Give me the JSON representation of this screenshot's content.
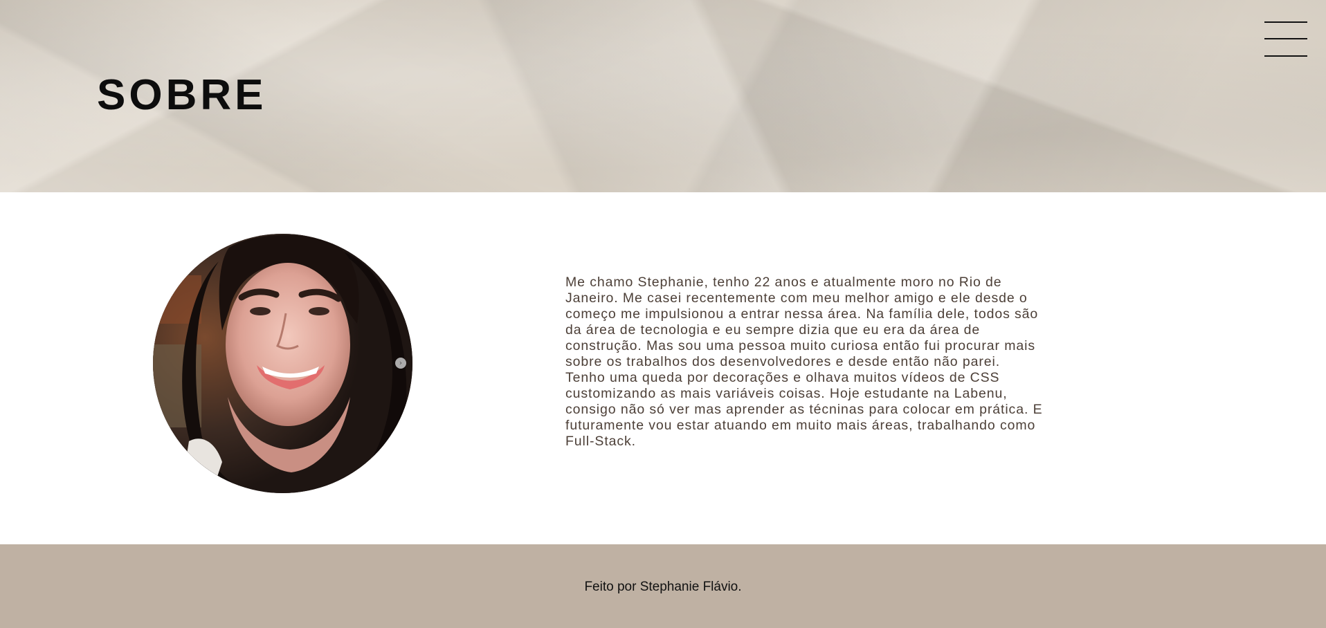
{
  "header": {
    "title": "SOBRE",
    "menu_icon": "hamburger-menu-icon"
  },
  "about": {
    "photo_alt": "Stephanie Flávio",
    "photo_nav_icon": "chevron-right-icon",
    "bio": "Me chamo Stephanie, tenho 22 anos e atualmente moro no Rio de Janeiro. Me casei recentemente com meu melhor amigo e ele desde o começo me impulsionou a entrar nessa área. Na família dele, todos são da área de tecnologia e eu sempre dizia que eu era da área de construção. Mas sou uma pessoa muito curiosa então fui procurar mais sobre os trabalhos dos desenvolvedores e desde então não parei. Tenho uma queda por decorações e olhava muitos vídeos de CSS customizando as mais variáveis coisas. Hoje estudante na Labenu, consigo não só ver mas aprender as técninas para colocar em prática. E futuramente vou estar atuando em muito mais áreas, trabalhando como Full-Stack."
  },
  "footer": {
    "text": "Feito por Stephanie Flávio."
  },
  "colors": {
    "header_paper": "#ddd5c9",
    "footer_bg": "#bfb1a3",
    "bio_text": "#4c3f37",
    "title_text": "#0d0d0d"
  }
}
